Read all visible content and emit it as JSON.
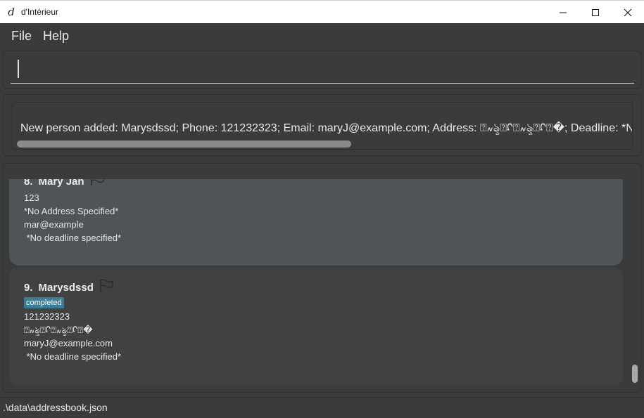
{
  "window": {
    "title": "d'Intérieur",
    "icon": "app-logo-icon"
  },
  "menu": {
    "items": [
      {
        "label": "File"
      },
      {
        "label": "Help"
      }
    ]
  },
  "command": {
    "value": "",
    "placeholder": ""
  },
  "result": {
    "message": "New person added: Marysdssd; Phone: 121232323; Email: maryJ@example.com; Address: ⍰៷ৡ⍰ᡗ⍰៷ৡ⍰ᡗ⍰�; Deadline: *No deadline specified*"
  },
  "persons": [
    {
      "index": "8.",
      "name": "Mary Jan",
      "tags": [],
      "phone": "123",
      "address": "*No Address Specified*",
      "email": "mar@example",
      "deadline": " *No deadline specified*",
      "selected": true
    },
    {
      "index": "9.",
      "name": "Marysdssd",
      "tags": [
        "completed"
      ],
      "phone": "121232323",
      "address": "⍰៷ৡ⍰ᡗ⍰៷ৡ⍰ᡗ⍰�",
      "email": "maryJ@example.com",
      "deadline": " *No deadline specified*",
      "selected": false
    }
  ],
  "status": {
    "path": ".\\data\\addressbook.json"
  },
  "colors": {
    "background": "#3a3b3d",
    "selected_card": "#4f5456",
    "card": "#3f4143",
    "tag": "#3b7d95"
  }
}
